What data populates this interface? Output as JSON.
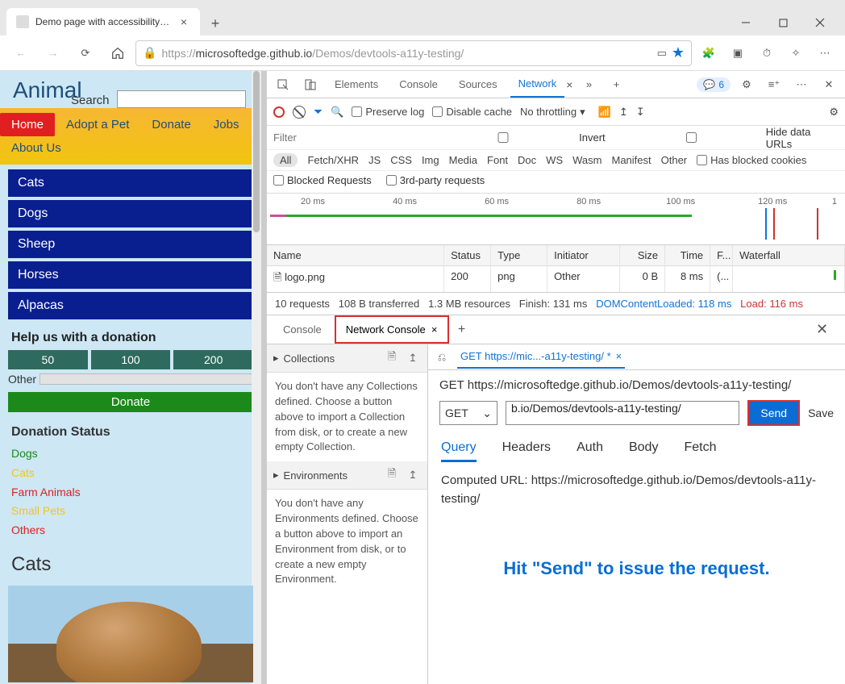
{
  "browser": {
    "tab_title": "Demo page with accessibility iss",
    "url_prefix": "https://",
    "url_host": "microsoftedge.github.io",
    "url_path": "/Demos/devtools-a11y-testing/"
  },
  "page": {
    "logo": "Animal",
    "search_label": "Search",
    "menu": {
      "home": "Home",
      "adopt": "Adopt a Pet",
      "donate": "Donate",
      "jobs": "Jobs",
      "about": "About Us"
    },
    "sidenav": [
      "Cats",
      "Dogs",
      "Sheep",
      "Horses",
      "Alpacas"
    ],
    "donate_heading": "Help us with a donation",
    "amounts": [
      "50",
      "100",
      "200"
    ],
    "other_label": "Other",
    "donate_btn": "Donate",
    "status_heading": "Donation Status",
    "status": [
      {
        "label": "Dogs",
        "color": "#1b8a1b"
      },
      {
        "label": "Cats",
        "color": "#f5c518"
      },
      {
        "label": "Farm Animals",
        "color": "#e02020"
      },
      {
        "label": "Small Pets",
        "color": "#f5c518"
      },
      {
        "label": "Others",
        "color": "#e02020"
      }
    ],
    "cats_heading": "Cats"
  },
  "devtools": {
    "tabs": {
      "elements": "Elements",
      "console": "Console",
      "sources": "Sources",
      "network": "Network"
    },
    "issues_count": "6",
    "toolbar": {
      "preserve": "Preserve log",
      "disable_cache": "Disable cache",
      "throttling": "No throttling"
    },
    "filter_placeholder": "Filter",
    "invert": "Invert",
    "hide_data": "Hide data URLs",
    "types": [
      "All",
      "Fetch/XHR",
      "JS",
      "CSS",
      "Img",
      "Media",
      "Font",
      "Doc",
      "WS",
      "Wasm",
      "Manifest",
      "Other"
    ],
    "has_blocked": "Has blocked cookies",
    "blocked_req": "Blocked Requests",
    "third_party": "3rd-party requests",
    "timeline_marks": [
      "20 ms",
      "40 ms",
      "60 ms",
      "80 ms",
      "100 ms",
      "120 ms",
      "1"
    ],
    "table": {
      "headers": {
        "name": "Name",
        "status": "Status",
        "type": "Type",
        "initiator": "Initiator",
        "size": "Size",
        "time": "Time",
        "f": "F...",
        "waterfall": "Waterfall"
      },
      "row": {
        "name": "logo.png",
        "status": "200",
        "type": "png",
        "initiator": "Other",
        "size": "0 B",
        "time": "8 ms",
        "f": "(..."
      }
    },
    "summary": {
      "req": "10 requests",
      "xfer": "108 B transferred",
      "res": "1.3 MB resources",
      "finish": "Finish: 131 ms",
      "dcl": "DOMContentLoaded: 118 ms",
      "load": "Load: 116 ms"
    }
  },
  "drawer": {
    "tabs": {
      "console": "Console",
      "network_console": "Network Console"
    },
    "collections_hdr": "Collections",
    "collections_body": "You don't have any Collections defined. Choose a button above to import a Collection from disk, or to create a new empty Collection.",
    "env_hdr": "Environments",
    "env_body": "You don't have any Environments defined. Choose a button above to import an Environment from disk, or to create a new empty Environment."
  },
  "network_console": {
    "req_tab": "GET https://mic...-a11y-testing/ *",
    "title": "GET https://microsoftedge.github.io/Demos/devtools-a11y-testing/",
    "method": "GET",
    "url_display": "b.io/Demos/devtools-a11y-testing/",
    "send": "Send",
    "save": "Save",
    "subtabs": [
      "Query",
      "Headers",
      "Auth",
      "Body",
      "Fetch"
    ],
    "computed": "Computed URL: https://microsoftedge.github.io/Demos/devtools-a11y-testing/",
    "hint": "Hit \"Send\" to issue the request."
  }
}
